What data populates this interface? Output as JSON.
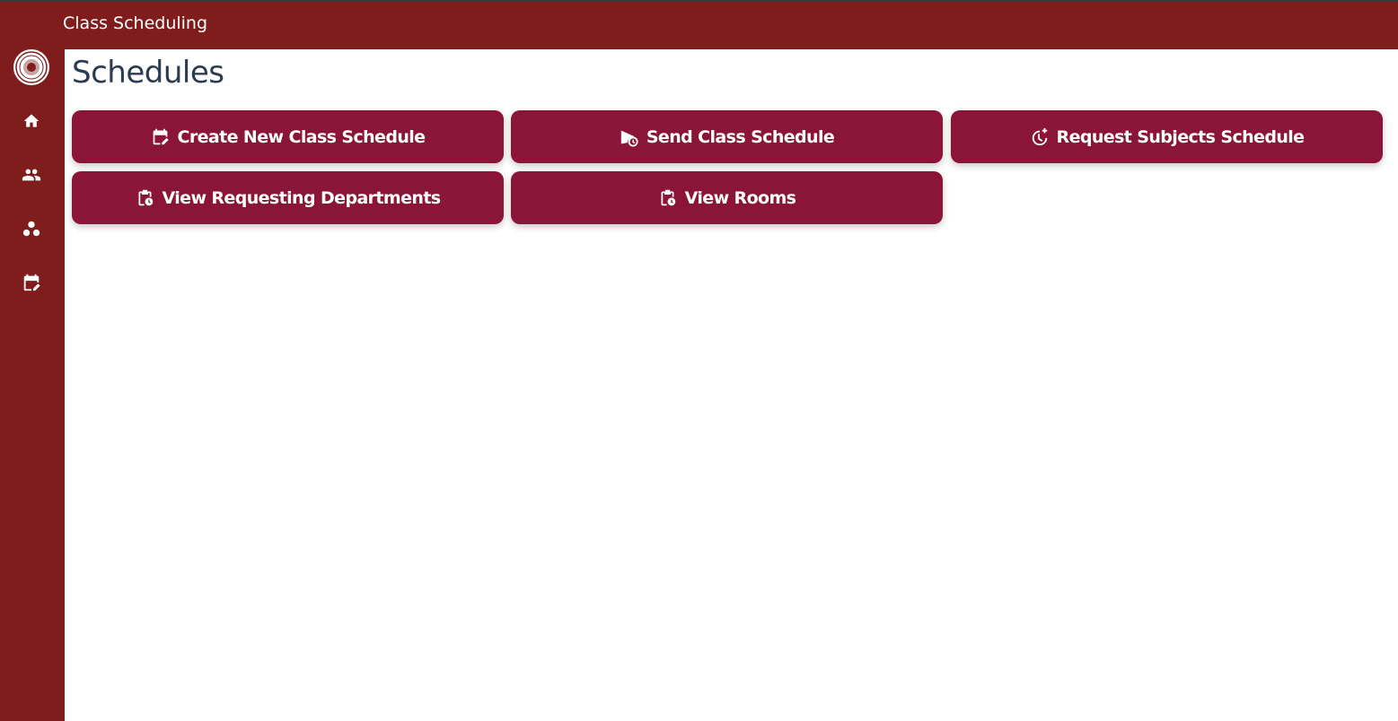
{
  "app": {
    "title": "Class Scheduling",
    "logo_icon": "university-seal-icon"
  },
  "sidebar": {
    "items": [
      {
        "icon": "home-icon"
      },
      {
        "icon": "people-icon"
      },
      {
        "icon": "groups-icon"
      },
      {
        "icon": "calendar-edit-icon"
      }
    ]
  },
  "main": {
    "title": "Schedules",
    "buttons": [
      {
        "label": "Create New Class Schedule",
        "icon": "calendar-edit-icon"
      },
      {
        "label": "Send Class Schedule",
        "icon": "send-schedule-icon"
      },
      {
        "label": "Request Subjects Schedule",
        "icon": "clock-plus-icon"
      },
      {
        "label": "View Requesting Departments",
        "icon": "clipboard-clock-icon"
      },
      {
        "label": "View Rooms",
        "icon": "clipboard-clock-icon"
      }
    ]
  },
  "colors": {
    "header_bg": "#7f1d1d",
    "sidebar_bg": "#7f1d1d",
    "button_bg": "#8b1538",
    "title_text": "#2b3a55"
  }
}
